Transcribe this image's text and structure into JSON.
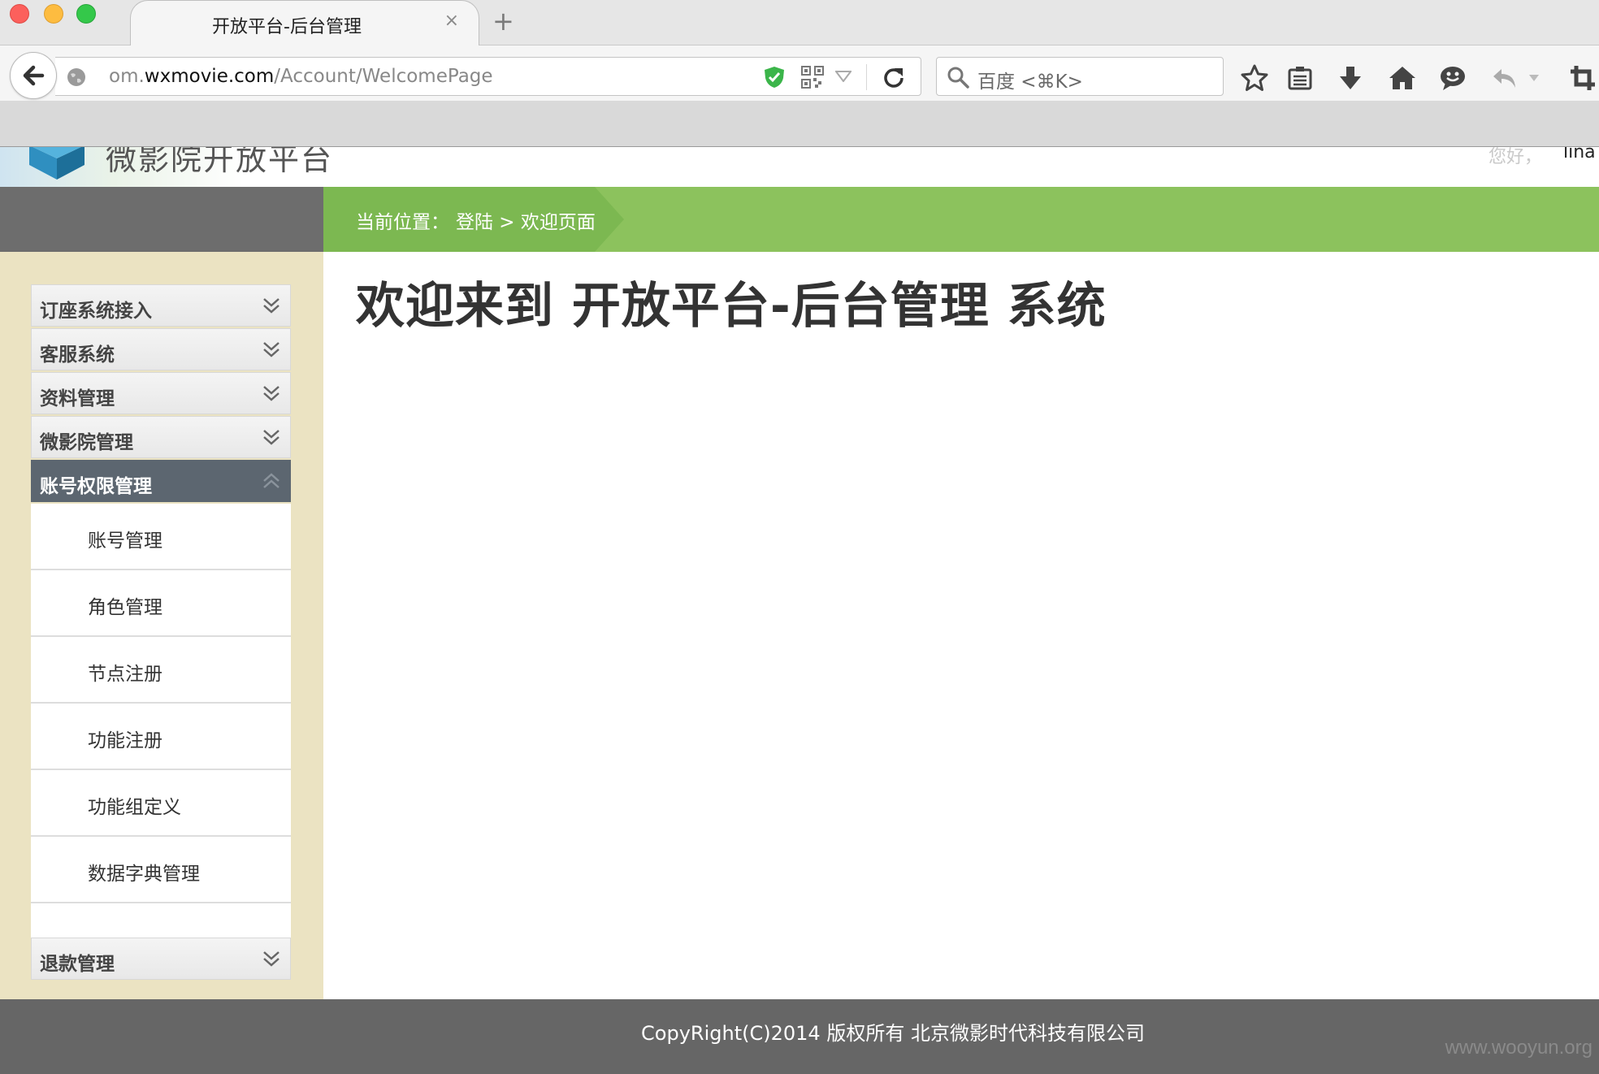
{
  "browser": {
    "tab_title": "开放平台-后台管理",
    "tab_close": "×",
    "new_tab": "+",
    "url_prefix": "om.",
    "url_domain": "wxmovie.com",
    "url_path": "/Account/WelcomePage",
    "search_placeholder": "百度 <⌘K>",
    "toolbar_icons": [
      "star-icon",
      "reading-list-icon",
      "download-icon",
      "home-icon",
      "chat-icon",
      "undo-icon",
      "crop-icon"
    ]
  },
  "header": {
    "site_name": "微影院开放平台",
    "greeting": "您好，",
    "username": "lina"
  },
  "breadcrumb": {
    "prefix": "当前位置：",
    "path": "登陆 > 欢迎页面"
  },
  "sidebar": {
    "sections": [
      {
        "label": "订座系统接入",
        "state": "collapsed"
      },
      {
        "label": "客服系统",
        "state": "collapsed"
      },
      {
        "label": "资料管理",
        "state": "collapsed"
      },
      {
        "label": "微影院管理",
        "state": "collapsed"
      },
      {
        "label": "账号权限管理",
        "state": "expanded"
      },
      {
        "label": "退款管理",
        "state": "collapsed"
      }
    ],
    "sub_items": [
      "账号管理",
      "角色管理",
      "节点注册",
      "功能注册",
      "功能组定义",
      "数据字典管理"
    ]
  },
  "main": {
    "title": "欢迎来到 开放平台-后台管理 系统"
  },
  "footer": {
    "copyright": "CopyRight(C)2014 版权所有 北京微影时代科技有限公司",
    "watermark": "www.wooyun.org"
  },
  "colors": {
    "breadcrumb_green": "#8cc25d",
    "sidebar_bg": "#ebe3c2",
    "active_menu": "#5c6670",
    "footer_bg": "#666666",
    "dark_bar": "#6d6d6d"
  }
}
